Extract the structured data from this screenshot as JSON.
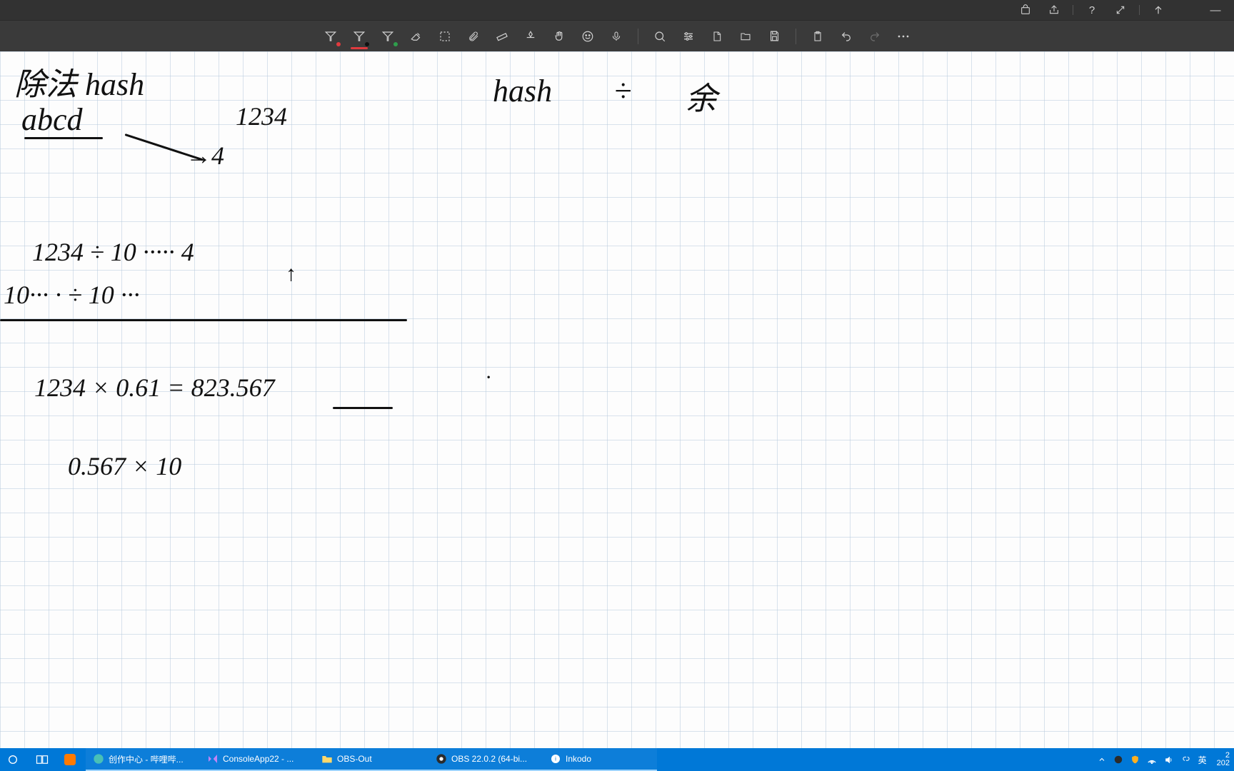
{
  "titlebar": {
    "icons": {
      "store": "store-icon",
      "share": "share-icon",
      "help": "?",
      "expand": "expand-icon",
      "arrow_up": "arrow-up-icon",
      "minimize": "—"
    }
  },
  "toolbar": {
    "pen1_color": "#e03a3e",
    "pen2_color": "#111111",
    "pen3_color": "#2e9e4c"
  },
  "ink": {
    "title_cn": "除法 hash",
    "abcd": "abcd",
    "n1234": "1234",
    "arrow4": "→4",
    "hash_right": "hash",
    "div_symbol": "÷",
    "yu_cn": "余",
    "line1": "1234 ÷ 10  ·····  4",
    "line1_arrow": "↑",
    "line2": "10··· · ÷ 10   ···",
    "eq1": "1234 × 0.61  =  823.567",
    "eq2": "0.567  ×  10",
    "dot": "·"
  },
  "taskbar": {
    "apps": [
      {
        "label": "创作中心 - 哔哩哔...",
        "icon": "edge",
        "color": "#49c0b6"
      },
      {
        "label": "ConsoleApp22 - ...",
        "icon": "vs",
        "color": "#c084f5"
      },
      {
        "label": "OBS-Out",
        "icon": "folder",
        "color": "#ffd86b"
      },
      {
        "label": "OBS 22.0.2 (64-bi...",
        "icon": "obs",
        "color": "#2b2b2b"
      },
      {
        "label": "Inkodo",
        "icon": "inkodo",
        "color": "#ffffff"
      }
    ],
    "ime": "英",
    "time_small": "2",
    "date_small": "202"
  }
}
